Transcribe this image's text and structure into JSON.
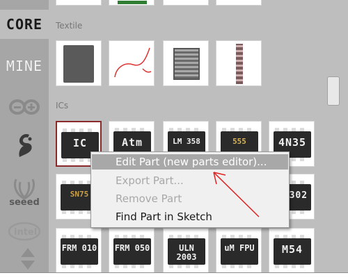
{
  "tabs": {
    "core": "CORE",
    "mine": "MINE",
    "seeed": "seeed"
  },
  "sections": {
    "textile": "Textile",
    "ics": "ICs"
  },
  "ic_parts_row1": [
    "IC",
    "Atm",
    "LM 358",
    "555",
    "4N35"
  ],
  "ic_parts_row2": [
    "SN75",
    "",
    "",
    "",
    "S 302"
  ],
  "ic_parts_row3": [
    "FRM 010",
    "FRM 050",
    "ULN 2003",
    "uM FPU",
    "M54"
  ],
  "context_menu": {
    "items": [
      {
        "label": "Edit Part (new parts editor)...",
        "state": "highlighted"
      },
      {
        "label": "Export Part...",
        "state": "disabled"
      },
      {
        "label": "Remove Part",
        "state": "disabled"
      },
      {
        "label": "Find Part in Sketch",
        "state": "enabled"
      }
    ]
  },
  "colors": {
    "annotation_arrow": "#e02020",
    "selected_border": "#8b2a2a",
    "menu_highlight": "#a8a8a8"
  }
}
